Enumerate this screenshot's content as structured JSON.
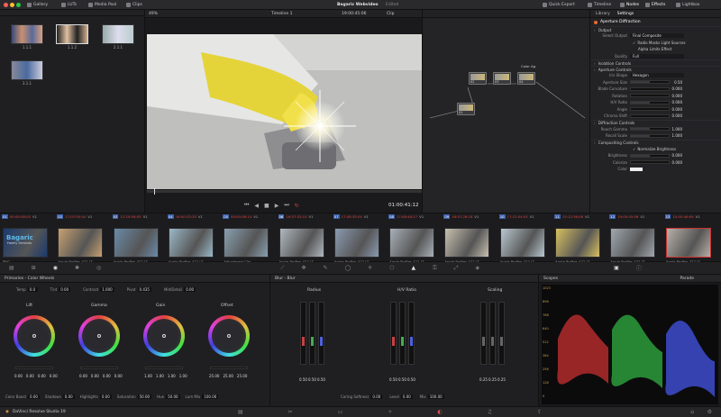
{
  "topbar": {
    "gallery": "Gallery",
    "luts": "LUTs",
    "media_pool": "Media Pool",
    "clips": "Clips",
    "project_title": "Bagaric Webvideo",
    "edited": "Edited",
    "quick_export": "Quick Export",
    "timeline": "Timeline",
    "nodes": "Nodes",
    "effects": "Effects",
    "lightbox": "Lightbox"
  },
  "viewer": {
    "zoom": "49%",
    "timeline_name": "Timeline 1",
    "timecode_top": "19:00:45:06",
    "clip_menu": "Clip",
    "timecode": "01:00:41:12"
  },
  "gallery": {
    "stills": [
      {
        "label": "1.1.1"
      },
      {
        "label": "1.1.2"
      },
      {
        "label": "2.1.1"
      },
      {
        "label": "3.1.1"
      }
    ]
  },
  "nodes": [
    {
      "label": "02"
    },
    {
      "label": "03"
    },
    {
      "label": "04"
    },
    {
      "label": "01"
    }
  ],
  "nodes_title": "Color Ag",
  "settings": {
    "tab_library": "Library",
    "tab_settings": "Settings",
    "title": "Aperture Diffraction",
    "output_header": "Output",
    "select_output_label": "Select Output",
    "select_output_value": "Final Composite",
    "cb1": "Radio Masks Light Sources",
    "cb2": "Alpha Limits Effect",
    "quality_label": "Quality",
    "quality_value": "Full",
    "isolation": "Isolation Controls",
    "aperture": "Aperture Controls",
    "iris_shape_label": "Iris Shape",
    "iris_shape_value": "Hexagon",
    "rows_aperture": [
      {
        "k": "Aperture Size",
        "v": "0.50",
        "fill": 0.5
      },
      {
        "k": "Blade Curvature",
        "v": "0.000",
        "fill": 0.0
      },
      {
        "k": "Rotation",
        "v": "0.000",
        "fill": 0.0
      },
      {
        "k": "H/V Ratio",
        "v": "0.000",
        "fill": 0.5
      },
      {
        "k": "Angle",
        "v": "0.000",
        "fill": 0.0
      },
      {
        "k": "Chroma Shift",
        "v": "0.000",
        "fill": 0.0
      }
    ],
    "diffraction": "Diffraction Controls",
    "rows_diffraction": [
      {
        "k": "Reach Gamma",
        "v": "1.000",
        "fill": 0.5
      },
      {
        "k": "Recall Scale",
        "v": "1.000",
        "fill": 0.5
      }
    ],
    "compositing": "Compositing Controls",
    "normalize": "Normalize Brightness",
    "rows_compositing": [
      {
        "k": "Brightness",
        "v": "0.000",
        "fill": 0.5
      },
      {
        "k": "Colorize",
        "v": "0.000",
        "fill": 0.0
      }
    ],
    "color_label": "Color"
  },
  "timeline": {
    "clips": [
      {
        "num": "01",
        "tc": "00:00:08:00",
        "track": "V1",
        "label": "PNG",
        "sub": "Bagaric",
        "sub2": "Family Services"
      },
      {
        "num": "02",
        "tc": "17:07:55:04",
        "track": "V1",
        "label": "Apple ProRes 422 LT"
      },
      {
        "num": "03",
        "tc": "12:29:08:05",
        "track": "V1",
        "label": "Apple ProRes 422 LT"
      },
      {
        "num": "04",
        "tc": "16:00:33:25",
        "track": "V1",
        "label": "Apple ProRes 422 LT"
      },
      {
        "num": "05",
        "tc": "00:00:08:14",
        "track": "V1",
        "label": "Adjustment Clip"
      },
      {
        "num": "06",
        "tc": "16:57:52:10",
        "track": "V1",
        "label": "Apple ProRes 422 LT"
      },
      {
        "num": "07",
        "tc": "17:08:35:04",
        "track": "V1",
        "label": "Apple ProRes 422 LT"
      },
      {
        "num": "08",
        "tc": "17:08:48:17",
        "track": "V1",
        "label": "Apple ProRes 422 LT"
      },
      {
        "num": "09",
        "tc": "16:57:26:18",
        "track": "V1",
        "label": "Apple ProRes 422 LT"
      },
      {
        "num": "10",
        "tc": "17:12:04:05",
        "track": "V1",
        "label": "Apple ProRes 422 LT"
      },
      {
        "num": "11",
        "tc": "13:12:36:06",
        "track": "V1",
        "label": "Apple ProRes 422 LT"
      },
      {
        "num": "12",
        "tc": "19:00:45:06",
        "track": "V1",
        "label": "Apple ProRes 422 LT"
      },
      {
        "num": "13",
        "tc": "10:00:46:09",
        "track": "V1",
        "label": "Apple ProRes 422 LT"
      }
    ]
  },
  "primaries": {
    "title": "Primaries - Color Wheels",
    "temp_label": "Temp",
    "temp": "0.0",
    "tint_label": "Tint",
    "tint": "0.00",
    "contrast_label": "Contrast",
    "contrast": "1.000",
    "pivot_label": "Pivot",
    "pivot": "0.435",
    "middetail_label": "Mid/Detail",
    "middetail": "0.00",
    "wheels": [
      {
        "name": "Lift",
        "vals": [
          "0.00",
          "0.00",
          "0.00",
          "0.00"
        ]
      },
      {
        "name": "Gamma",
        "vals": [
          "0.00",
          "0.00",
          "0.00",
          "0.00"
        ]
      },
      {
        "name": "Gain",
        "vals": [
          "1.00",
          "1.00",
          "1.00",
          "1.00"
        ]
      },
      {
        "name": "Offset",
        "vals": [
          "25.00",
          "25.00",
          "25.00"
        ]
      }
    ],
    "bottom": [
      {
        "k": "Color Boost",
        "v": "0.00"
      },
      {
        "k": "Shadows",
        "v": "0.00"
      },
      {
        "k": "Highlights",
        "v": "0.00"
      },
      {
        "k": "Saturation",
        "v": "50.00"
      },
      {
        "k": "Hue",
        "v": "50.00"
      },
      {
        "k": "Lum Mix",
        "v": "100.00"
      }
    ]
  },
  "blur": {
    "title": "Blur - Blur",
    "groups": [
      {
        "name": "Radius",
        "vals": [
          "0.50",
          "0.50",
          "0.50"
        ]
      },
      {
        "name": "H/V Ratio",
        "vals": [
          "0.50",
          "0.50",
          "0.50"
        ]
      },
      {
        "name": "Scaling",
        "vals": [
          "0.25",
          "0.25",
          "0.25"
        ]
      }
    ],
    "footer": [
      {
        "k": "Coring Softness",
        "v": "0.00"
      },
      {
        "k": "Level",
        "v": "0.00"
      },
      {
        "k": "Mix",
        "v": "100.00"
      }
    ]
  },
  "scopes": {
    "title": "Scopes",
    "mode": "Parade",
    "ticks": [
      "1023",
      "896",
      "768",
      "640",
      "512",
      "384",
      "256",
      "128",
      "0"
    ]
  },
  "statusbar": {
    "app": "DaVinci Resolve Studio 19"
  }
}
